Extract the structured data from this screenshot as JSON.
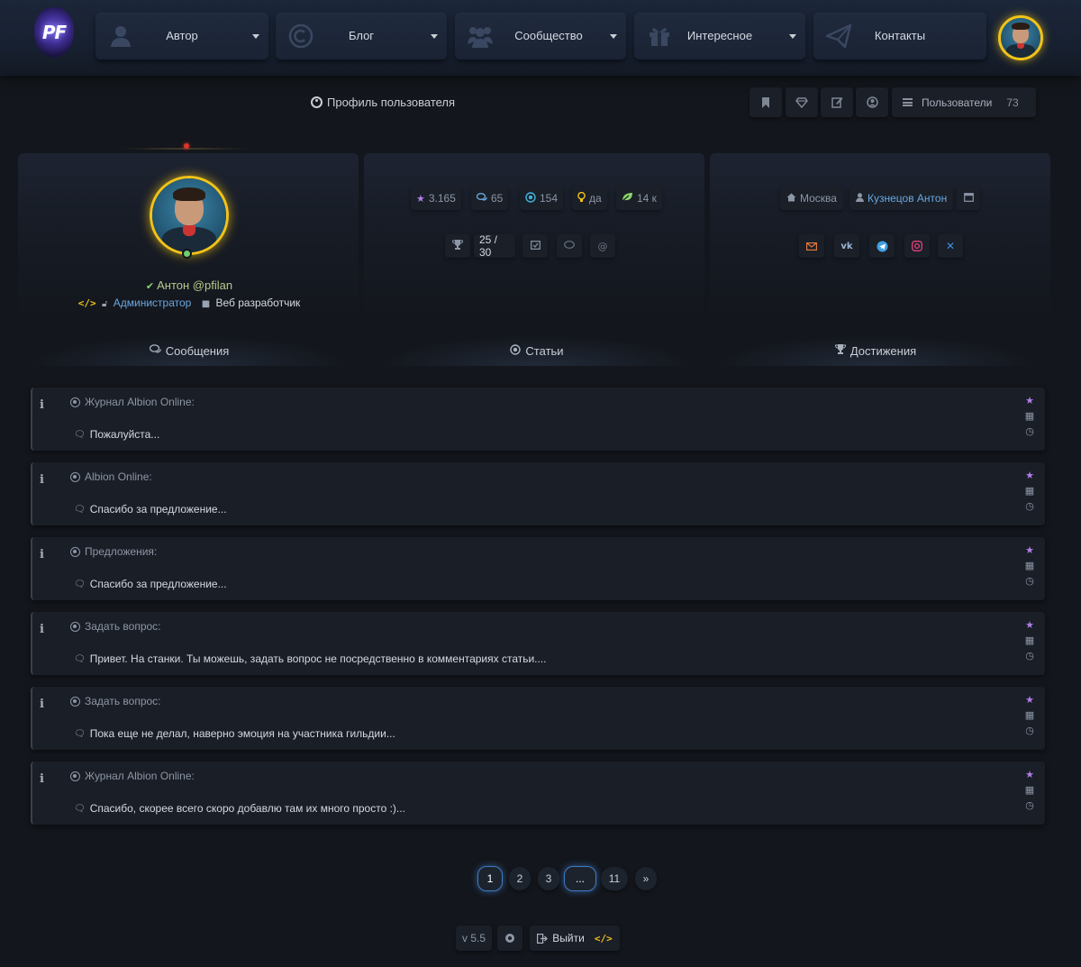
{
  "nav": {
    "logo_text": "PF",
    "items": [
      {
        "label": "Автор",
        "icon": "user-icon"
      },
      {
        "label": "Блог",
        "icon": "copyright-icon"
      },
      {
        "label": "Сообщество",
        "icon": "users-icon"
      },
      {
        "label": "Интересное",
        "icon": "gift-icon"
      },
      {
        "label": "Контакты",
        "icon": "paper-plane-icon"
      }
    ]
  },
  "header": {
    "title": "Профиль пользователя",
    "users_label": "Пользователи",
    "users_count": "73"
  },
  "profile": {
    "name": "Антон @pfilan",
    "role": "Администратор",
    "job": "Веб разработчик",
    "stats": {
      "rating": "3.165",
      "comments": "65",
      "articles": "154",
      "idea": "да",
      "leaf": "14 к"
    },
    "achievements": "25 / 30",
    "city": "Москва",
    "full_name": "Кузнецов Антон"
  },
  "colors": {
    "accent_gold": "#f2c318",
    "accent_blue": "#3f7ac2",
    "star_purple": "#b07ee8"
  },
  "tabs": [
    {
      "label": "Сообщения",
      "icon": "comments-icon"
    },
    {
      "label": "Статьи",
      "icon": "dot-circle-icon"
    },
    {
      "label": "Достижения",
      "icon": "trophy-icon"
    }
  ],
  "messages": [
    {
      "topic": "Журнал Albion Online:",
      "text": "Пожалуйста..."
    },
    {
      "topic": "Albion Online:",
      "text": "Спасибо за предложение..."
    },
    {
      "topic": "Предложения:",
      "text": "Спасибо за предложение..."
    },
    {
      "topic": "Задать вопрос:",
      "text": "Привет. На станки. Ты можешь, задать вопрос не посредственно в комментариях статьи...."
    },
    {
      "topic": "Задать вопрос:",
      "text": "Пока еще не делал, наверно эмоция на участника гильдии..."
    },
    {
      "topic": "Журнал Albion Online:",
      "text": "Спасибо, скорее всего скоро добавлю там их много просто :)..."
    }
  ],
  "pagination": {
    "pages": [
      "1",
      "2",
      "3",
      "...",
      "11"
    ],
    "current": "1",
    "next": "»"
  },
  "footer": {
    "version": "v 5.5",
    "logout": "Выйти"
  }
}
